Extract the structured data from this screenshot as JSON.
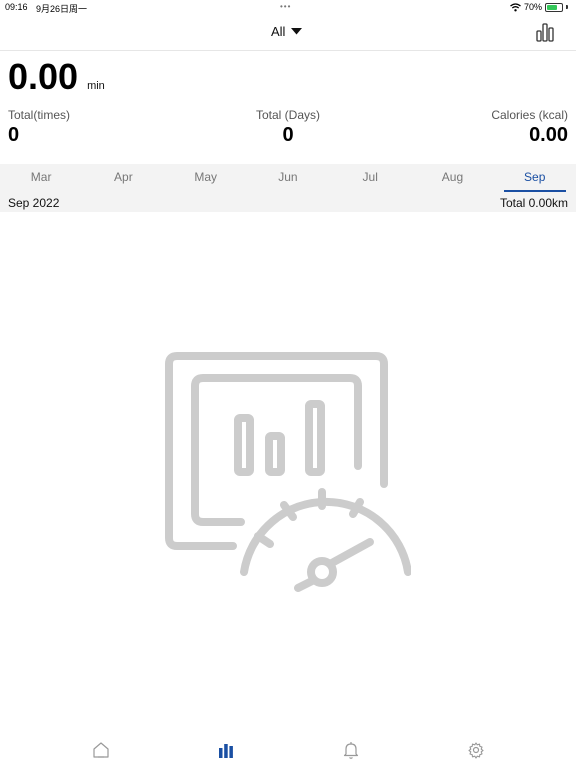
{
  "status_bar": {
    "time": "09:16",
    "date": "9月26日周一",
    "battery": "70%",
    "battery_level": 0.7
  },
  "header": {
    "filter_label": "All"
  },
  "summary": {
    "duration_value": "0.00",
    "duration_unit": "min"
  },
  "stats": [
    {
      "label": "Total(times)",
      "value": "0"
    },
    {
      "label": "Total (Days)",
      "value": "0"
    },
    {
      "label": "Calories (kcal)",
      "value": "0.00"
    }
  ],
  "months": {
    "tabs": [
      "Mar",
      "Apr",
      "May",
      "Jun",
      "Jul",
      "Aug",
      "Sep"
    ],
    "selected": "Sep",
    "period": "Sep 2022",
    "total": "Total 0.00km"
  },
  "colors": {
    "accent": "#1a4fa3",
    "placeholder_icon": "#cccccc",
    "tab_inactive": "#999999"
  },
  "icons": {
    "empty_state": "dashboard-speedometer-chart-icon",
    "tabbar": [
      "home-icon",
      "bar-chart-icon",
      "bell-icon",
      "gear-icon"
    ]
  }
}
